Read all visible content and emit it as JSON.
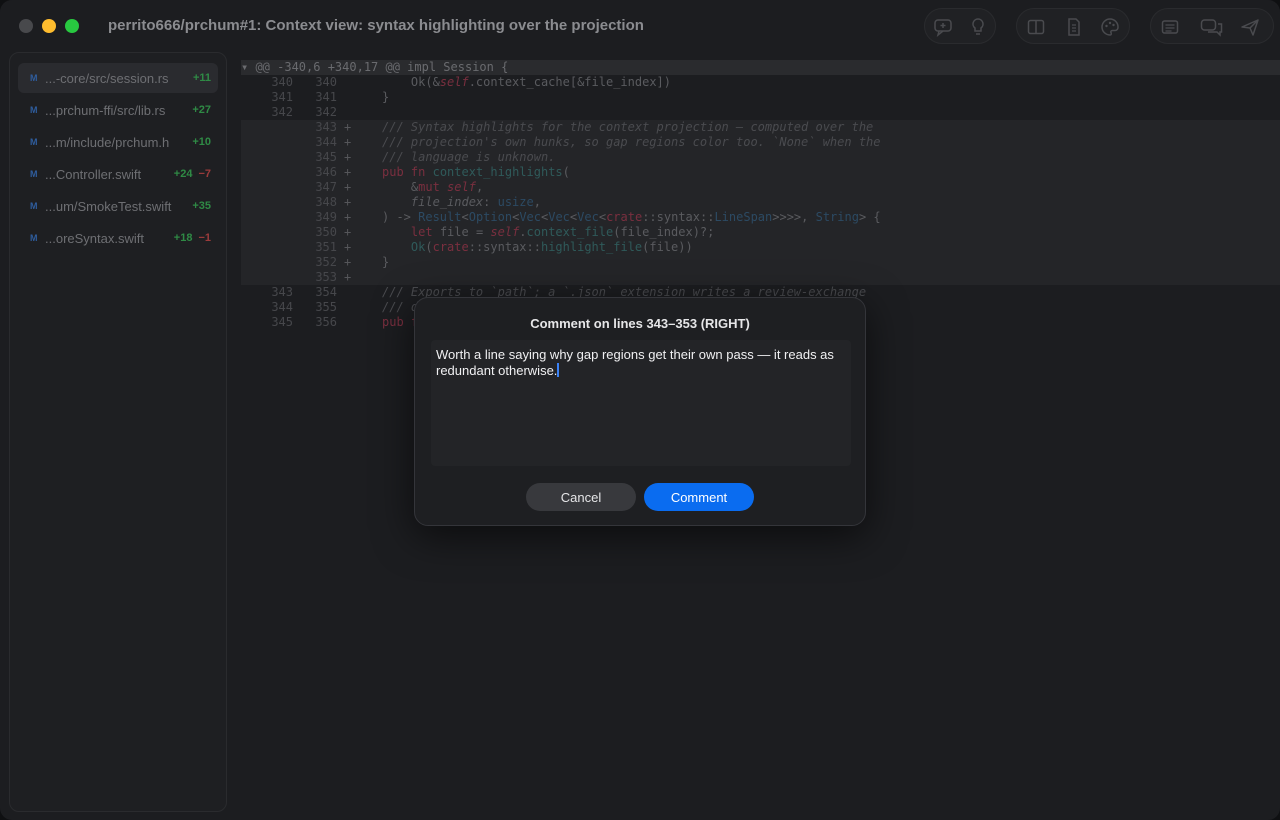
{
  "window": {
    "title": "perrito666/prchum#1: Context view: syntax highlighting over the projection"
  },
  "toolbar": {
    "groups": [
      [
        "comment-add-icon",
        "lightbulb-icon"
      ],
      [
        "split-view-icon",
        "document-icon",
        "palette-icon"
      ],
      [
        "list-icon",
        "chat-bubbles-icon",
        "send-icon"
      ]
    ]
  },
  "sidebar": {
    "files": [
      {
        "status": "M",
        "name": "...-core/src/session.rs",
        "added": "+11",
        "removed": "",
        "selected": true
      },
      {
        "status": "M",
        "name": "...prchum-ffi/src/lib.rs",
        "added": "+27",
        "removed": ""
      },
      {
        "status": "M",
        "name": "...m/include/prchum.h",
        "added": "+10",
        "removed": ""
      },
      {
        "status": "M",
        "name": "...Controller.swift",
        "added": "+24",
        "removed": "−7"
      },
      {
        "status": "M",
        "name": "...um/SmokeTest.swift",
        "added": "+35",
        "removed": ""
      },
      {
        "status": "M",
        "name": "...oreSyntax.swift",
        "added": "+18",
        "removed": "−1"
      }
    ]
  },
  "diff": {
    "hunk_header": "▾ @@ -340,6 +340,17 @@ impl Session {",
    "lines": [
      {
        "old": "340",
        "new": "340",
        "mark": "",
        "html": "    Ok(&amp;<span class=\"c-self\">self</span>.context_cache[&amp;file_index])"
      },
      {
        "old": "341",
        "new": "341",
        "mark": "",
        "html": "}"
      },
      {
        "old": "342",
        "new": "342",
        "mark": "",
        "html": ""
      },
      {
        "old": "",
        "new": "343",
        "mark": "+",
        "html": "<span class=\"c-com\">/// Syntax highlights for the context projection — computed over the</span>"
      },
      {
        "old": "",
        "new": "344",
        "mark": "+",
        "html": "<span class=\"c-com\">/// projection's own hunks, so gap regions color too. `None` when the</span>"
      },
      {
        "old": "",
        "new": "345",
        "mark": "+",
        "html": "<span class=\"c-com\">/// language is unknown.</span>"
      },
      {
        "old": "",
        "new": "346",
        "mark": "+",
        "html": "<span class=\"c-kw\">pub fn</span> <span class=\"c-fn\">context_highlights</span>("
      },
      {
        "old": "",
        "new": "347",
        "mark": "+",
        "html": "    &amp;<span class=\"c-kw\">mut</span> <span class=\"c-self\">self</span>,"
      },
      {
        "old": "",
        "new": "348",
        "mark": "+",
        "html": "    <span class=\"c-it\">file_index</span>: <span class=\"c-ty\">usize</span>,"
      },
      {
        "old": "",
        "new": "349",
        "mark": "+",
        "html": ") -&gt; <span class=\"c-ty\">Result</span>&lt;<span class=\"c-ty\">Option</span>&lt;<span class=\"c-ty\">Vec</span>&lt;<span class=\"c-ty\">Vec</span>&lt;<span class=\"c-ty\">Vec</span>&lt;<span class=\"c-kw\">crate</span>::syntax::<span class=\"c-ty\">LineSpan</span>&gt;&gt;&gt;&gt;, <span class=\"c-ty\">String</span>&gt; {"
      },
      {
        "old": "",
        "new": "350",
        "mark": "+",
        "html": "    <span class=\"c-kw\">let</span> file = <span class=\"c-self\">self</span>.<span class=\"c-fn\">context_file</span>(file_index)?;"
      },
      {
        "old": "",
        "new": "351",
        "mark": "+",
        "html": "    <span class=\"c-fn\">Ok</span>(<span class=\"c-kw\">crate</span>::syntax::<span class=\"c-fn\">highlight_file</span>(file))"
      },
      {
        "old": "",
        "new": "352",
        "mark": "+",
        "html": "}"
      },
      {
        "old": "",
        "new": "353",
        "mark": "+",
        "html": ""
      },
      {
        "old": "343",
        "new": "354",
        "mark": "",
        "html": "<span class=\"c-com\">/// Exports to `path`; a `.json` extension writes a review-exchange</span>"
      },
      {
        "old": "344",
        "new": "355",
        "mark": "",
        "html": "<span class=\"c-com\">/// d</span>"
      },
      {
        "old": "345",
        "new": "356",
        "mark": "",
        "html": "<span class=\"c-kw\">pub f</span>"
      }
    ]
  },
  "modal": {
    "title": "Comment on lines 343–353 (RIGHT)",
    "text": "Worth a line saying why gap regions get their own pass — it reads as redundant otherwise.",
    "cancel_label": "Cancel",
    "comment_label": "Comment"
  }
}
